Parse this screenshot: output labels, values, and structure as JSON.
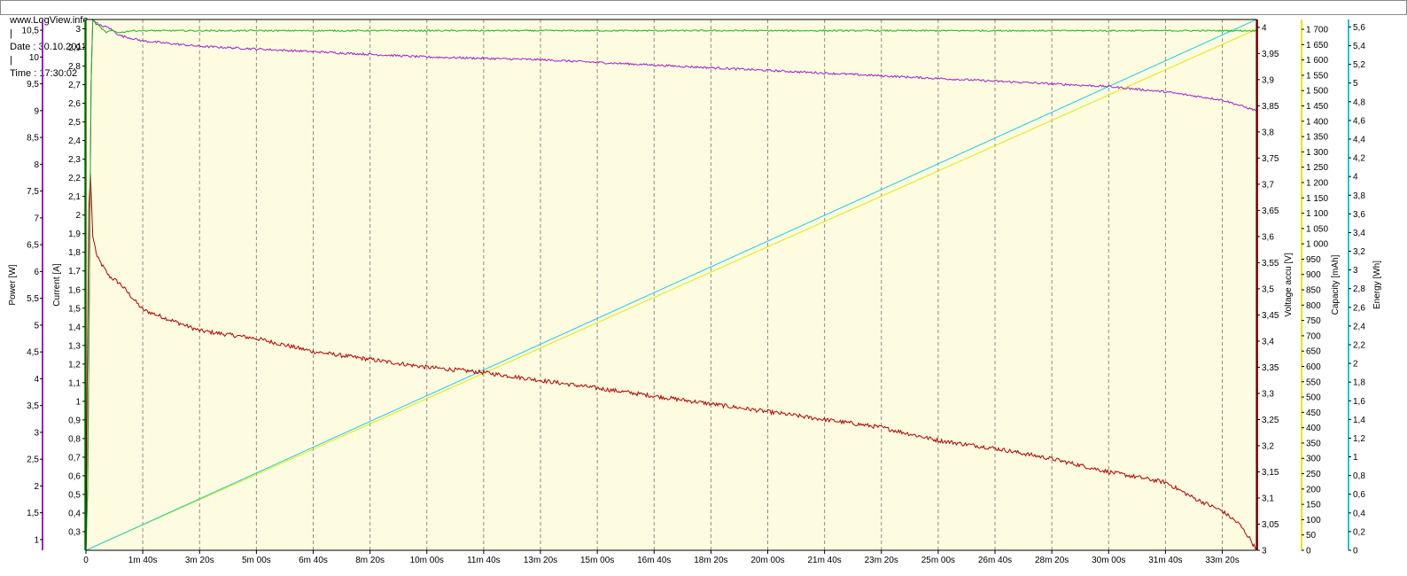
{
  "header": {
    "site": "www.LogView.info",
    "date_text": "Date : 30.10.2011",
    "time_text": "Time : 17:30:02",
    "separator": "|"
  },
  "colors": {
    "plot_background": "#fdfce0",
    "power": "#a020c8",
    "current": "#1eb41e",
    "voltage": "#b40000",
    "capacity": "#e6e600",
    "energy": "#1ec8e6",
    "gridline": "#8c8c8c"
  },
  "chart_data": {
    "type": "line",
    "x": {
      "unit": "seconds",
      "range": [
        0,
        2060
      ],
      "ticks": [
        0,
        100,
        200,
        300,
        400,
        500,
        600,
        700,
        800,
        900,
        1000,
        1100,
        1200,
        1300,
        1400,
        1500,
        1600,
        1700,
        1800,
        1900,
        2000
      ],
      "tick_labels": [
        "0",
        "1m 40s",
        "3m 20s",
        "5m 00s",
        "6m 40s",
        "8m 20s",
        "10m 00s",
        "11m 40s",
        "13m 20s",
        "15m 00s",
        "16m 40s",
        "18m 20s",
        "20m 00s",
        "21m 40s",
        "23m 20s",
        "25m 00s",
        "26m 40s",
        "28m 20s",
        "30m 00s",
        "31m 40s",
        "33m 20s"
      ]
    },
    "vertical_grid": "dashed at every x tick",
    "axes": [
      {
        "id": "power",
        "label": "Power [W]",
        "side": "left",
        "order": 1,
        "range": [
          0.8,
          10.7
        ],
        "tick_labels": [
          "1",
          "1,5",
          "2",
          "2,5",
          "3",
          "3,5",
          "4",
          "4,5",
          "5",
          "5,5",
          "6",
          "6,5",
          "7",
          "7,5",
          "8",
          "8,5",
          "9",
          "9,5",
          "10",
          "10,5"
        ],
        "tick_values": [
          1,
          1.5,
          2,
          2.5,
          3,
          3.5,
          4,
          4.5,
          5,
          5.5,
          6,
          6.5,
          7,
          7.5,
          8,
          8.5,
          9,
          9.5,
          10,
          10.5
        ]
      },
      {
        "id": "current",
        "label": "Current [A]",
        "side": "left",
        "order": 2,
        "range": [
          0.2,
          3.05
        ],
        "tick_labels": [
          "0,3",
          "0,4",
          "0,5",
          "0,6",
          "0,7",
          "0,8",
          "0,9",
          "1",
          "1,1",
          "1,2",
          "1,3",
          "1,4",
          "1,5",
          "1,6",
          "1,7",
          "1,8",
          "1,9",
          "2",
          "2,1",
          "2,2",
          "2,3",
          "2,4",
          "2,5",
          "2,6",
          "2,7",
          "2,8",
          "2,9",
          "3"
        ],
        "tick_values": [
          0.3,
          0.4,
          0.5,
          0.6,
          0.7,
          0.8,
          0.9,
          1.0,
          1.1,
          1.2,
          1.3,
          1.4,
          1.5,
          1.6,
          1.7,
          1.8,
          1.9,
          2.0,
          2.1,
          2.2,
          2.3,
          2.4,
          2.5,
          2.6,
          2.7,
          2.8,
          2.9,
          3.0
        ]
      },
      {
        "id": "voltage",
        "label": "Voltage accu [V]",
        "side": "right",
        "order": 1,
        "range": [
          3.0,
          4.015
        ],
        "tick_labels": [
          "3",
          "3,05",
          "3,1",
          "3,15",
          "3,2",
          "3,25",
          "3,3",
          "3,35",
          "3,4",
          "3,45",
          "3,5",
          "3,55",
          "3,6",
          "3,65",
          "3,7",
          "3,75",
          "3,8",
          "3,85",
          "3,9",
          "3,95",
          "4"
        ],
        "tick_values": [
          3.0,
          3.05,
          3.1,
          3.15,
          3.2,
          3.25,
          3.3,
          3.35,
          3.4,
          3.45,
          3.5,
          3.55,
          3.6,
          3.65,
          3.7,
          3.75,
          3.8,
          3.85,
          3.9,
          3.95,
          4.0
        ]
      },
      {
        "id": "capacity",
        "label": "Capacity [mAh]",
        "side": "right",
        "order": 2,
        "range": [
          0,
          1732
        ],
        "tick_labels": [
          "0",
          "50",
          "100",
          "150",
          "200",
          "250",
          "300",
          "350",
          "400",
          "450",
          "500",
          "550",
          "600",
          "650",
          "700",
          "750",
          "800",
          "850",
          "900",
          "950",
          "1 000",
          "1 050",
          "1 100",
          "1 150",
          "1 200",
          "1 250",
          "1 300",
          "1 350",
          "1 400",
          "1 450",
          "1 500",
          "1 550",
          "1 600",
          "1 650",
          "1 700"
        ],
        "tick_values": [
          0,
          50,
          100,
          150,
          200,
          250,
          300,
          350,
          400,
          450,
          500,
          550,
          600,
          650,
          700,
          750,
          800,
          850,
          900,
          950,
          1000,
          1050,
          1100,
          1150,
          1200,
          1250,
          1300,
          1350,
          1400,
          1450,
          1500,
          1550,
          1600,
          1650,
          1700
        ]
      },
      {
        "id": "energy",
        "label": "Energy [Wh]",
        "side": "right",
        "order": 3,
        "range": [
          0,
          5.68
        ],
        "tick_labels": [
          "0",
          "0,2",
          "0,4",
          "0,6",
          "0,8",
          "1",
          "1,2",
          "1,4",
          "1,6",
          "1,8",
          "2",
          "2,2",
          "2,4",
          "2,6",
          "2,8",
          "3",
          "3,2",
          "3,4",
          "3,6",
          "3,8",
          "4",
          "4,2",
          "4,4",
          "4,6",
          "4,8",
          "5",
          "5,2",
          "5,4",
          "5,6"
        ],
        "tick_values": [
          0,
          0.2,
          0.4,
          0.6,
          0.8,
          1.0,
          1.2,
          1.4,
          1.6,
          1.8,
          2.0,
          2.2,
          2.4,
          2.6,
          2.8,
          3.0,
          3.2,
          3.4,
          3.6,
          3.8,
          4.0,
          4.2,
          4.4,
          4.6,
          4.8,
          5.0,
          5.2,
          5.4,
          5.6
        ]
      }
    ],
    "series": [
      {
        "axis": "current",
        "color": "#1eb41e",
        "noise": 0.004,
        "points": [
          [
            0,
            0.22
          ],
          [
            3,
            0.5
          ],
          [
            6,
            1.6
          ],
          [
            9,
            2.7
          ],
          [
            12,
            3.05
          ],
          [
            20,
            3.03
          ],
          [
            25,
            3.01
          ],
          [
            35,
            2.98
          ],
          [
            45,
            2.99
          ],
          [
            60,
            2.98
          ],
          [
            80,
            2.99
          ],
          [
            100,
            2.99
          ],
          [
            2060,
            2.99
          ]
        ]
      },
      {
        "axis": "power",
        "color": "#a020c8",
        "noise": 0.02,
        "points": [
          [
            0,
            0.8
          ],
          [
            3,
            2.0
          ],
          [
            6,
            5.5
          ],
          [
            9,
            9.5
          ],
          [
            12,
            10.7
          ],
          [
            20,
            10.6
          ],
          [
            40,
            10.55
          ],
          [
            60,
            10.4
          ],
          [
            100,
            10.3
          ],
          [
            200,
            10.2
          ],
          [
            400,
            10.1
          ],
          [
            600,
            10.0
          ],
          [
            800,
            9.95
          ],
          [
            1000,
            9.85
          ],
          [
            1200,
            9.75
          ],
          [
            1400,
            9.65
          ],
          [
            1600,
            9.55
          ],
          [
            1800,
            9.45
          ],
          [
            1900,
            9.35
          ],
          [
            2000,
            9.2
          ],
          [
            2060,
            9.0
          ]
        ]
      },
      {
        "axis": "voltage",
        "color": "#b40000",
        "noise": 0.004,
        "points": [
          [
            0,
            3.0
          ],
          [
            2,
            3.3
          ],
          [
            5,
            3.65
          ],
          [
            8,
            3.72
          ],
          [
            12,
            3.6
          ],
          [
            20,
            3.56
          ],
          [
            40,
            3.525
          ],
          [
            60,
            3.51
          ],
          [
            100,
            3.46
          ],
          [
            200,
            3.42
          ],
          [
            300,
            3.405
          ],
          [
            400,
            3.38
          ],
          [
            500,
            3.365
          ],
          [
            600,
            3.35
          ],
          [
            700,
            3.34
          ],
          [
            800,
            3.325
          ],
          [
            900,
            3.31
          ],
          [
            1000,
            3.295
          ],
          [
            1100,
            3.28
          ],
          [
            1200,
            3.265
          ],
          [
            1300,
            3.25
          ],
          [
            1400,
            3.235
          ],
          [
            1500,
            3.21
          ],
          [
            1600,
            3.195
          ],
          [
            1700,
            3.175
          ],
          [
            1800,
            3.15
          ],
          [
            1900,
            3.13
          ],
          [
            1950,
            3.1
          ],
          [
            2000,
            3.075
          ],
          [
            2030,
            3.05
          ],
          [
            2050,
            3.02
          ],
          [
            2060,
            3.0
          ]
        ]
      },
      {
        "axis": "capacity",
        "color": "#e6e600",
        "noise": 0,
        "points": [
          [
            0,
            0
          ],
          [
            2060,
            1700
          ]
        ]
      },
      {
        "axis": "energy",
        "color": "#1ec8e6",
        "noise": 0,
        "points": [
          [
            0,
            0
          ],
          [
            2060,
            5.68
          ]
        ]
      }
    ]
  }
}
